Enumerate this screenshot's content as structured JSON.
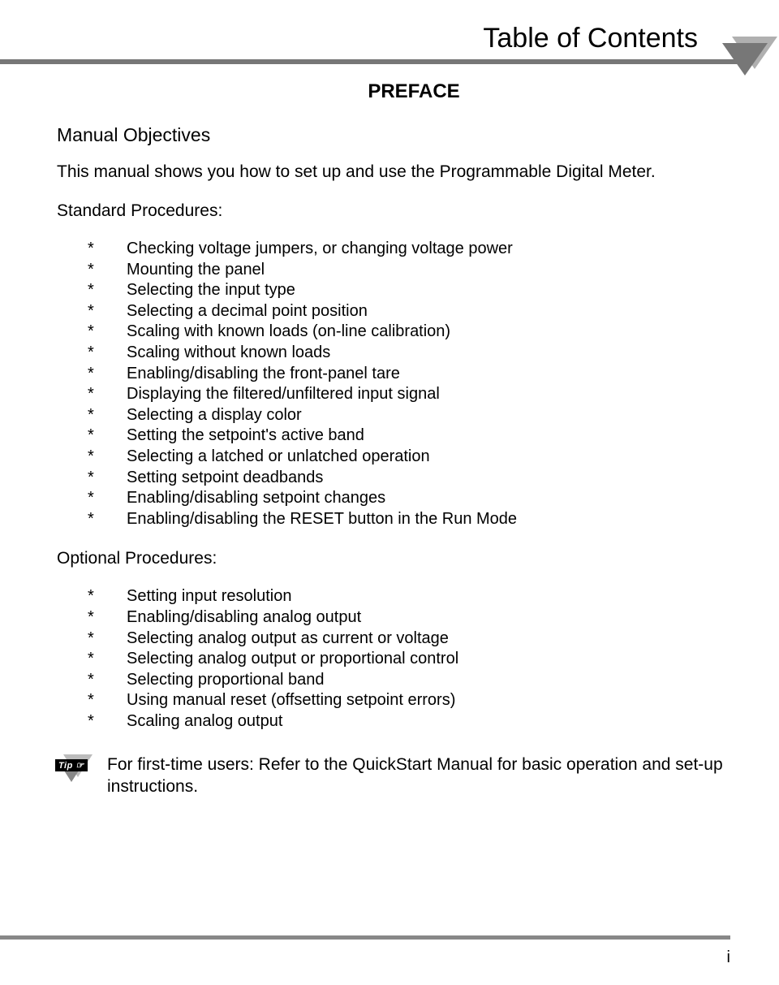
{
  "title": "Table of Contents",
  "preface": "PREFACE",
  "section1_heading": "Manual Objectives",
  "intro": "This manual shows you how to set up and use the Programmable Digital Meter.",
  "standard_heading": "Standard Procedures:",
  "standard_items": [
    "Checking voltage jumpers, or changing voltage power",
    "Mounting the panel",
    "Selecting the input type",
    "Selecting a decimal point position",
    "Scaling with known loads (on-line calibration)",
    "Scaling without known loads",
    "Enabling/disabling the front-panel tare",
    "Displaying the filtered/unfiltered input signal",
    "Selecting a display color",
    "Setting the setpoint's active band",
    "Selecting a latched or unlatched operation",
    "Setting setpoint deadbands",
    "Enabling/disabling setpoint changes",
    "Enabling/disabling the RESET button in the Run Mode"
  ],
  "optional_heading": "Optional Procedures:",
  "optional_items": [
    "Setting input resolution",
    "Enabling/disabling analog output",
    "Selecting analog output as current or voltage",
    "Selecting analog output or proportional control",
    "Selecting proportional band",
    "Using manual reset (offsetting setpoint errors)",
    "Scaling analog output"
  ],
  "tip_label": "Tip ☞",
  "tip_text": "For first-time users:  Refer to the QuickStart Manual for basic operation and set-up instructions.",
  "page_number": "i"
}
